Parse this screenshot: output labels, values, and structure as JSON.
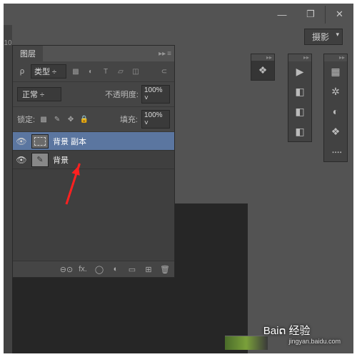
{
  "titlebar": {
    "min": "—",
    "restore": "❐",
    "close": "✕"
  },
  "options": {
    "workspace": "摄影"
  },
  "left_edge": "10",
  "panel": {
    "title": "图层",
    "filter": {
      "kind": "类型",
      "kind_prefix": "ρ"
    },
    "blend": {
      "mode": "正常",
      "opacity_label": "不透明度:",
      "opacity": "100%"
    },
    "lock": {
      "label": "锁定:",
      "fill_label": "填充:",
      "fill": "100%"
    },
    "layers": [
      {
        "name": "背景 副本",
        "selected": true
      },
      {
        "name": "背景",
        "selected": false
      }
    ],
    "bottom_icons": [
      "⊖⊙",
      "fx.",
      "◯",
      "◐",
      "▭",
      "⊞",
      "🗑"
    ]
  },
  "dock": {
    "c1": [
      "❖"
    ],
    "c2": [
      "▶",
      "◧",
      "◧",
      "◧"
    ],
    "c3": [
      "▦",
      "✲",
      "◐",
      "❖",
      "᠁"
    ]
  },
  "watermark": {
    "brand": "Baiດ",
    "text": "经验",
    "sub": "jingyan.baidu.com"
  }
}
